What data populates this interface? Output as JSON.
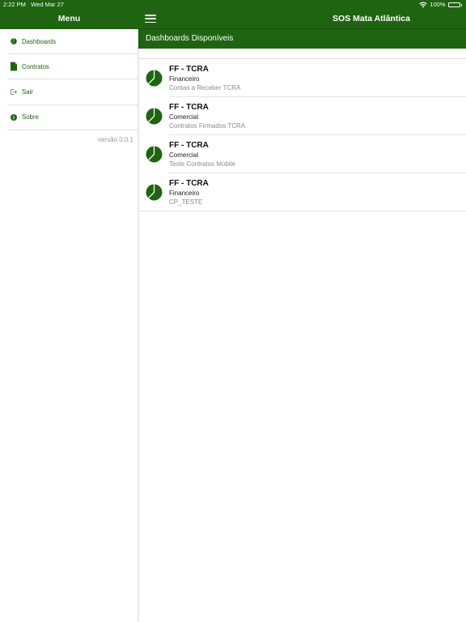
{
  "status_bar": {
    "time": "2:22 PM",
    "date": "Wed Mar 27",
    "battery": "100%"
  },
  "sidebar": {
    "title": "Menu",
    "items": [
      {
        "label": "Dashboards",
        "icon": "pie-chart-icon"
      },
      {
        "label": "Contratos",
        "icon": "document-icon"
      },
      {
        "label": "Sair",
        "icon": "logout-icon"
      },
      {
        "label": "Sobre",
        "icon": "info-icon"
      }
    ],
    "version": "versão 0.0.1"
  },
  "header": {
    "title": "SOS Mata Atlântica",
    "menu_icon": "hamburger-icon"
  },
  "subheader": {
    "title": "Dashboards Disponíveis"
  },
  "dashboards": [
    {
      "title": "FF - TCRA",
      "category": "Financeiro",
      "description": "Contas a Receber TCRA"
    },
    {
      "title": "FF - TCRA",
      "category": "Comercial",
      "description": "Contratos Firmados TCRA"
    },
    {
      "title": "FF - TCRA",
      "category": "Comercial",
      "description": "Teste Contratos Mobile"
    },
    {
      "title": "FF - TCRA",
      "category": "Financeiro",
      "description": "CP_TESTE"
    }
  ],
  "colors": {
    "brand_green": "#1f6411",
    "muted_text": "#8c8c8c"
  }
}
